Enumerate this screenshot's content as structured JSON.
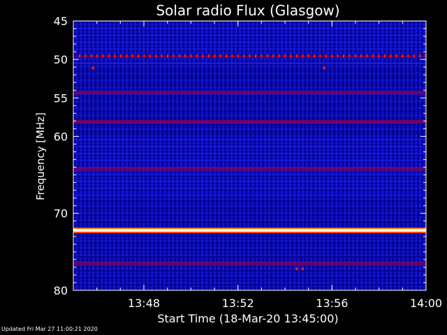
{
  "chart_data": {
    "type": "heatmap",
    "title": "Solar radio Flux (Glasgow)",
    "xlabel": "Start Time (18-Mar-20 13:45:00)",
    "ylabel": "Frequency [MHz]",
    "xlim": [
      "13:45",
      "14:00"
    ],
    "ylim": [
      45,
      80
    ],
    "y_reversed": true,
    "x_ticks": [
      "13:48",
      "13:52",
      "13:56",
      "14:00"
    ],
    "y_ticks": [
      45,
      50,
      55,
      60,
      70,
      80
    ],
    "colormap": [
      "#00006e",
      "#0000ff",
      "#8a0055",
      "#ff2000",
      "#ffff00",
      "#ffffff"
    ],
    "bands": [
      {
        "freq": 49.6,
        "intensity": 0.75,
        "type": "dashed"
      },
      {
        "freq": 50.5,
        "intensity": 0.5,
        "type": "dashed-faint"
      },
      {
        "freq": 54.3,
        "intensity": 0.6,
        "type": "band"
      },
      {
        "freq": 58.1,
        "intensity": 0.55,
        "type": "band"
      },
      {
        "freq": 64.2,
        "intensity": 0.55,
        "type": "band"
      },
      {
        "freq": 72.2,
        "intensity": 1.0,
        "type": "band"
      },
      {
        "freq": 76.5,
        "intensity": 0.45,
        "type": "band"
      }
    ],
    "spots": [
      {
        "time": "13:45:50",
        "freq": 51.1
      },
      {
        "time": "13:55:40",
        "freq": 51.1
      },
      {
        "time": "13:54:30",
        "freq": 77.2
      },
      {
        "time": "13:54:45",
        "freq": 77.2
      }
    ]
  },
  "footer": {
    "updated": "Updated Fri Mar 27 11:00:21 2020"
  }
}
